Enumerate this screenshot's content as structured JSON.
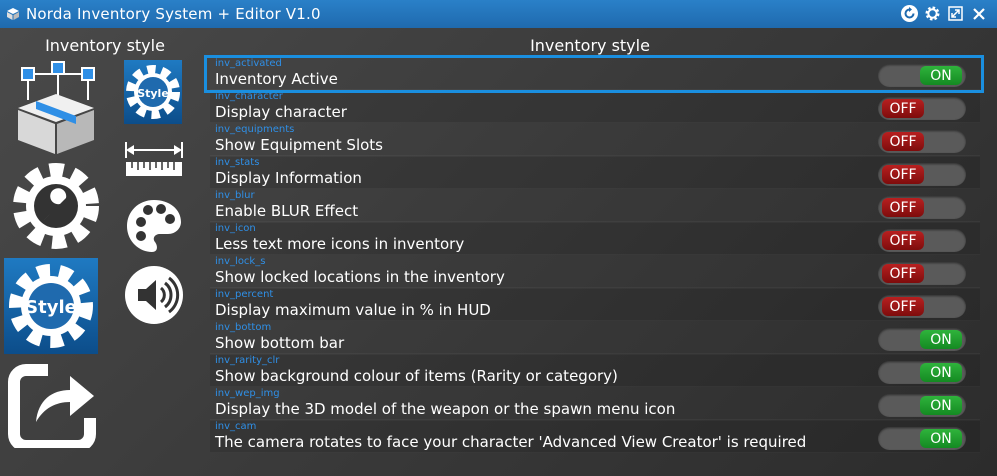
{
  "window": {
    "title": "Norda Inventory System + Editor V1.0"
  },
  "sidebar": {
    "heading": "Inventory style",
    "nav_items": [
      {
        "id": "inventory",
        "icon": "inventory-box-icon"
      },
      {
        "id": "tools",
        "icon": "wrench-gear-icon"
      },
      {
        "id": "style",
        "icon": "style-gear-icon",
        "label": "Style",
        "selected": true
      },
      {
        "id": "export",
        "icon": "export-arrow-icon"
      }
    ],
    "sub_items": [
      {
        "id": "sub-style",
        "icon": "style-gear-icon",
        "label": "Style",
        "selected": true
      },
      {
        "id": "sub-size",
        "icon": "ruler-icon"
      },
      {
        "id": "sub-color",
        "icon": "palette-icon"
      },
      {
        "id": "sub-sound",
        "icon": "speaker-icon"
      }
    ]
  },
  "main": {
    "heading": "Inventory style",
    "settings": [
      {
        "key": "inv_activated",
        "label": "Inventory Active",
        "state": "ON",
        "on": true
      },
      {
        "key": "inv_character",
        "label": "Display character",
        "state": "OFF",
        "on": false
      },
      {
        "key": "inv_equipments",
        "label": "Show Equipment Slots",
        "state": "OFF",
        "on": false
      },
      {
        "key": "inv_stats",
        "label": "Display Information",
        "state": "OFF",
        "on": false
      },
      {
        "key": "inv_blur",
        "label": "Enable BLUR Effect",
        "state": "OFF",
        "on": false
      },
      {
        "key": "inv_icon",
        "label": "Less text more icons in inventory",
        "state": "OFF",
        "on": false
      },
      {
        "key": "inv_lock_s",
        "label": "Show locked locations in the inventory",
        "state": "OFF",
        "on": false
      },
      {
        "key": "inv_percent",
        "label": "Display maximum value in % in HUD",
        "state": "OFF",
        "on": false
      },
      {
        "key": "inv_bottom",
        "label": "Show bottom bar",
        "state": "ON",
        "on": true
      },
      {
        "key": "inv_rarity_clr",
        "label": "Show background colour of items (Rarity or category)",
        "state": "ON",
        "on": true
      },
      {
        "key": "inv_wep_img",
        "label": "Display the 3D model of the weapon or the spawn menu icon",
        "state": "ON",
        "on": true
      },
      {
        "key": "inv_cam",
        "label": "The camera rotates to face your character 'Advanced View Creator' is required",
        "state": "ON",
        "on": true
      }
    ]
  },
  "colors": {
    "titlebar": "#1f6aae",
    "accent": "#1a8fe0",
    "on": "#1e9e2c",
    "off": "#9a1414",
    "key_text": "#2f8fe6"
  }
}
